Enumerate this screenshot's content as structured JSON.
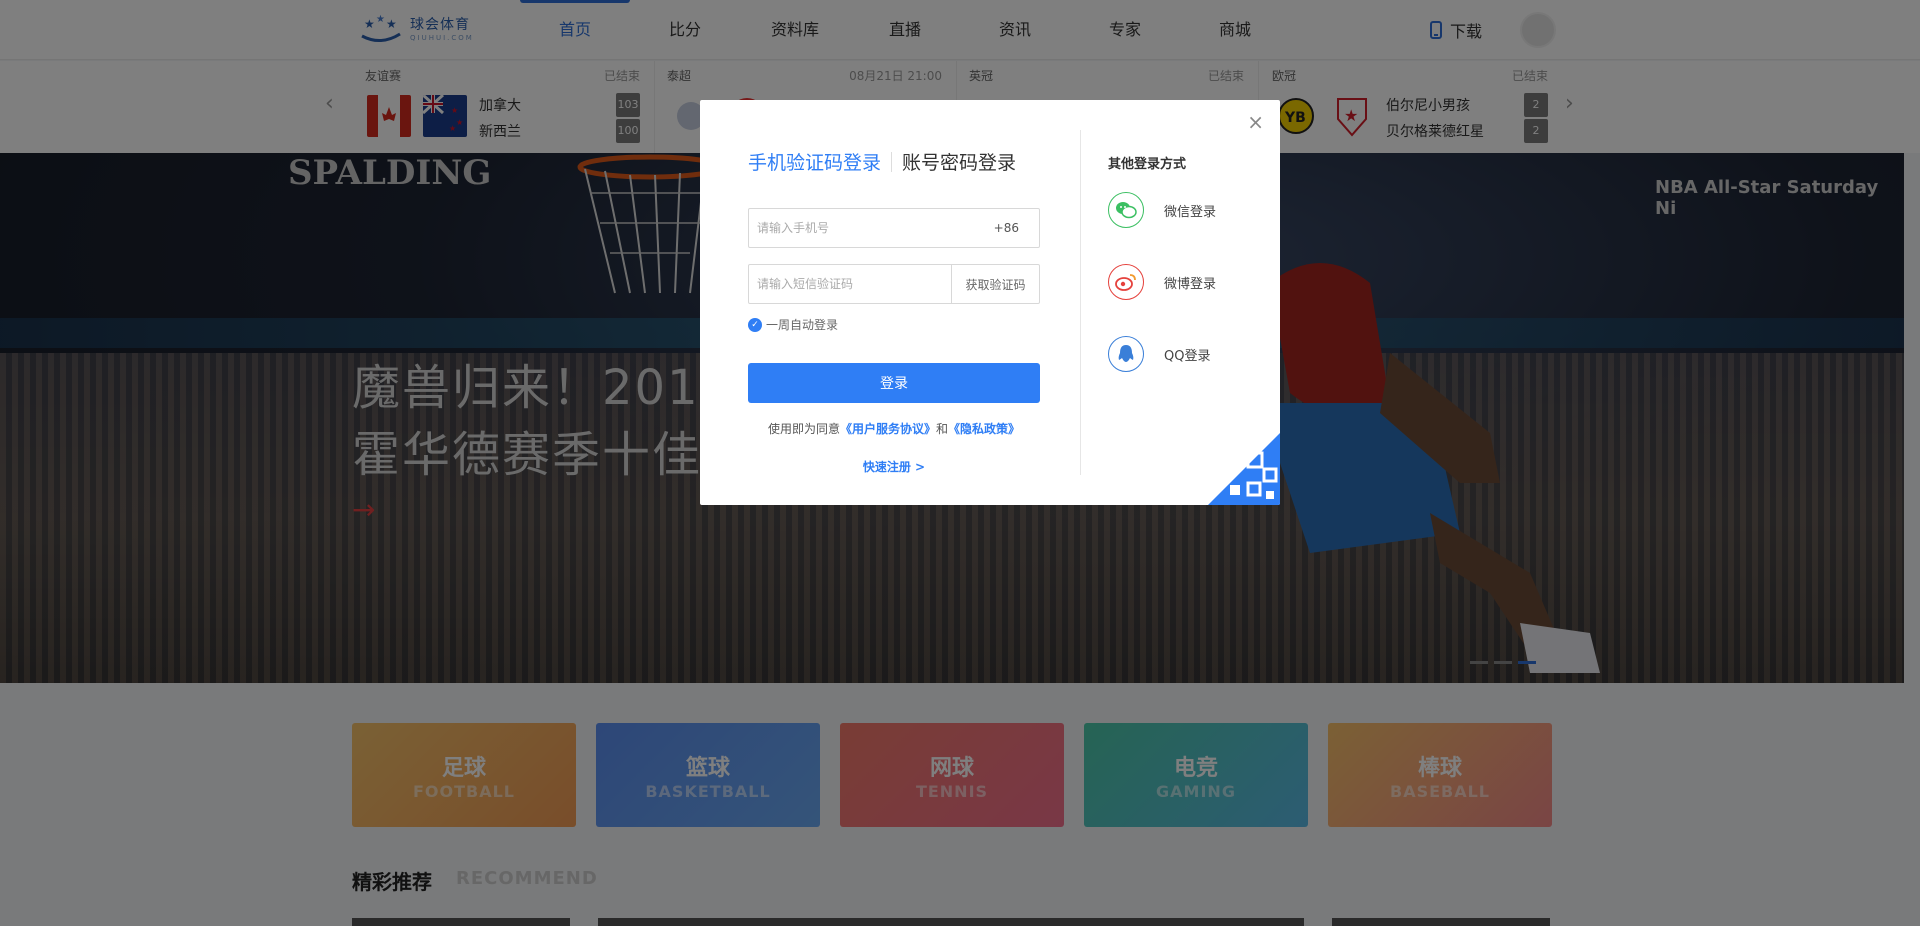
{
  "header": {
    "logo_cn": "球会体育",
    "logo_en": "QIUHUI.COM",
    "nav": [
      "首页",
      "比分",
      "资料库",
      "直播",
      "资讯",
      "专家",
      "商城"
    ],
    "download": "下载"
  },
  "matches": [
    {
      "league": "友谊赛",
      "status": "已结束",
      "team1": "加拿大",
      "team2": "新西兰",
      "score1": "103",
      "score2": "100"
    },
    {
      "league": "泰超",
      "status": "08月21日 21:00",
      "team1": "",
      "team2": "",
      "score1": "",
      "score2": ""
    },
    {
      "league": "英冠",
      "status": "已结束",
      "team1": "",
      "team2": "",
      "score1": "",
      "score2": ""
    },
    {
      "league": "欧冠",
      "status": "已结束",
      "team1": "伯尔尼小男孩",
      "team2": "贝尔格莱德红星",
      "score1": "2",
      "score2": "2"
    }
  ],
  "banner": {
    "brand": "SPALDING",
    "allstar": "NBA All-Star Saturday Ni",
    "title1": "魔兽归来！2017",
    "title2": "霍华德赛季十佳",
    "arrow": "→"
  },
  "categories": [
    {
      "cn": "足球",
      "en": "FOOTBALL"
    },
    {
      "cn": "篮球",
      "en": "BASKETBALL"
    },
    {
      "cn": "网球",
      "en": "TENNIS"
    },
    {
      "cn": "电竞",
      "en": "GAMING"
    },
    {
      "cn": "棒球",
      "en": "BASEBALL"
    }
  ],
  "recommend": {
    "title": "精彩推荐",
    "en": "RECOMMEND"
  },
  "modal": {
    "tab_sms": "手机验证码登录",
    "tab_password": "账号密码登录",
    "phone_placeholder": "请输入手机号",
    "prefix": "+86",
    "code_placeholder": "请输入短信验证码",
    "get_code": "获取验证码",
    "remember": "一周自动登录",
    "login": "登录",
    "agree_prefix": "使用即为同意",
    "agree_terms": "《用户服务协议》",
    "agree_and": "和",
    "agree_privacy": "《隐私政策》",
    "register": "快速注册 >",
    "close": "×",
    "other_title": "其他登录方式",
    "wechat": "微信登录",
    "weibo": "微博登录",
    "qq": "QQ登录"
  },
  "colors": {
    "accent": "#2f7ef5",
    "wechat": "#3bbf62",
    "weibo": "#e5413c",
    "qq": "#3a7fd8"
  }
}
